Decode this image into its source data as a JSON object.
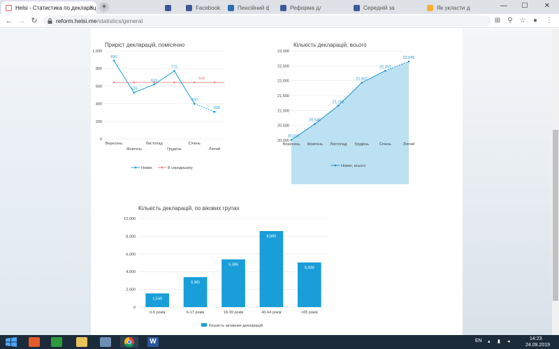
{
  "browser": {
    "tabs": [
      {
        "title": "Helsi - Статистика по декларації",
        "active": true
      },
      {
        "title": "",
        "active": false
      },
      {
        "title": "Facebook",
        "active": false
      },
      {
        "title": "Пенсійний фонд Україн",
        "active": false
      },
      {
        "title": "Реформа для медичн",
        "active": false
      },
      {
        "title": "Середній зарп - Реф",
        "active": false
      },
      {
        "title": "Як укласти декларац",
        "active": false
      }
    ],
    "new_tab": "+",
    "window_controls": {
      "minimize": "—",
      "maximize": "☐",
      "close": "✕"
    },
    "url_host": "reform.helsi.me",
    "url_path": "/statistics/general"
  },
  "charts": {
    "monthly": {
      "title": "Приріст декларацій, помісячно",
      "legend_new": "Нових",
      "legend_avg": "В середньому"
    },
    "total": {
      "title": "Кількість декларацій, всього",
      "legend": "Нових, всього"
    },
    "age": {
      "title": "Кількість декларацій, по вікових групах",
      "legend": "Кількість активних декларацій"
    }
  },
  "chart_data": [
    {
      "type": "line",
      "title": "Приріст декларацій, помісячно",
      "categories": [
        "Вересень",
        "Жовтень",
        "Листопад",
        "Грудень",
        "Січень",
        "Лютий"
      ],
      "series": [
        {
          "name": "Нових",
          "values": [
            890,
            526,
            619,
            772,
            400,
            308
          ],
          "color": "#29a3d8"
        },
        {
          "name": "В середньому",
          "values": [
            642,
            642,
            642,
            642,
            642,
            642
          ],
          "color": "#f08080"
        }
      ],
      "avg_label": 642,
      "ylim": [
        0,
        1000
      ],
      "yticks": [
        "0",
        "200",
        "400",
        "600",
        "800",
        "1,000"
      ]
    },
    {
      "type": "area",
      "title": "Кількість декларацій, всього",
      "categories": [
        "Вересень",
        "Жовтень",
        "Листопад",
        "Грудень",
        "Січень",
        "Лютий"
      ],
      "series": [
        {
          "name": "Нових, всього",
          "values": [
            20016,
            20546,
            21165,
            21937,
            22337,
            22645
          ],
          "labels": [
            "20,016",
            "20,546",
            "21,165",
            "21,937",
            "22,337",
            "22,645"
          ],
          "color": "#29a3d8"
        }
      ],
      "ylim": [
        20000,
        23000
      ],
      "yticks": [
        "20,000",
        "20,500",
        "21,000",
        "21,500",
        "22,000",
        "22,500",
        "23,000"
      ]
    },
    {
      "type": "bar",
      "title": "Кількість декларацій, по вікових групах",
      "categories": [
        "0-5 років",
        "6-17 років",
        "18-39 років",
        "40-64 років",
        ">65 років"
      ],
      "series": [
        {
          "name": "Кількість активних декларацій",
          "values": [
            1549,
            3381,
            5386,
            8585,
            5039
          ],
          "labels": [
            "1,549",
            "3,381",
            "5,386",
            "8,585",
            "5,039"
          ],
          "color": "#1a9ed9"
        }
      ],
      "ylim": [
        0,
        10000
      ],
      "yticks": [
        "0",
        "2,000",
        "4,000",
        "6,000",
        "8,000",
        "10,000"
      ]
    }
  ],
  "taskbar": {
    "lang": "EN",
    "time": "14:23",
    "date": "24.09.2019"
  }
}
